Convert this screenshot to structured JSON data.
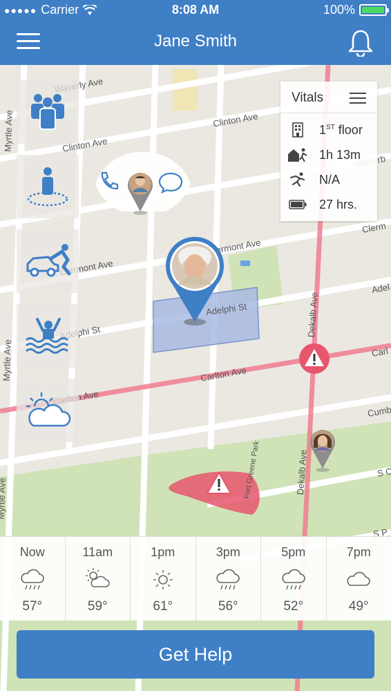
{
  "status_bar": {
    "carrier": "Carrier",
    "time": "8:08 AM",
    "battery": "100%"
  },
  "header": {
    "title": "Jane Smith"
  },
  "map": {
    "streets": {
      "waverly": "Waverly Ave",
      "clinton_left": "Clinton Ave",
      "clinton_right": "Clinton Ave",
      "vanderbilt": "Vanderb",
      "clermont_mid": "Clermont Ave",
      "clermont_top": "Clermont Ave",
      "clermont_right": "Clerm",
      "adelphi_mid": "Adelphi St",
      "adelphi_left": "Adelphi St",
      "adelphi_right": "Adel",
      "carlton_mid": "Carlton Ave",
      "carlton_left": "Carlton Ave",
      "carlton_right": "Carl",
      "cumberland": "Cumb",
      "s_right_1": "S O",
      "s_right_2": "S P",
      "myrtle_top": "Myrtle Ave",
      "myrtle_mid": "Myrtle Ave",
      "myrtle_bottom": "Myrtle Ave",
      "dekalb_top": "Dekalb Ave",
      "dekalb_bottom": "Dekalb Ave",
      "park": "Fort Greene Park"
    }
  },
  "vitals": {
    "title": "Vitals",
    "floor_number": "1",
    "floor_suffix": "ST",
    "floor_label": " floor",
    "time_away": "1h 13m",
    "activity": "N/A",
    "battery_left": "27 hrs."
  },
  "weather": [
    {
      "time": "Now",
      "icon": "rain-cloud-icon",
      "temp": "57°"
    },
    {
      "time": "11am",
      "icon": "partly-sunny-icon",
      "temp": "59°"
    },
    {
      "time": "1pm",
      "icon": "sun-icon",
      "temp": "61°"
    },
    {
      "time": "3pm",
      "icon": "rain-cloud-icon",
      "temp": "56°"
    },
    {
      "time": "5pm",
      "icon": "rain-cloud-icon",
      "temp": "52°"
    },
    {
      "time": "7pm",
      "icon": "cloud-icon",
      "temp": "49°"
    }
  ],
  "help_button": {
    "label": "Get Help"
  },
  "colors": {
    "brand": "#3f7fc6",
    "alert": "#e8566d",
    "highlight": "#a9bbe3"
  }
}
